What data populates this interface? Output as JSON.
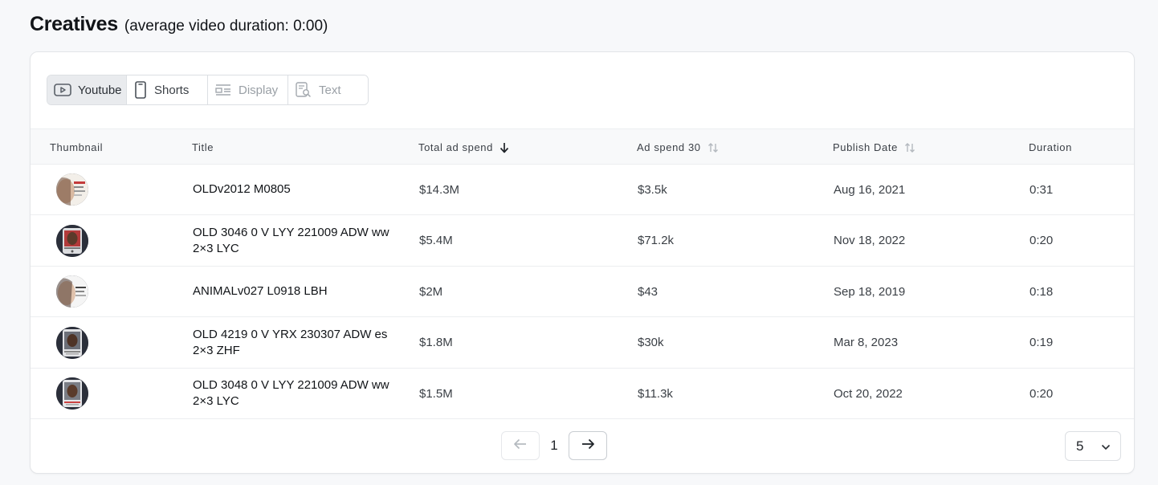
{
  "section": {
    "title": "Creatives",
    "subtitle": "(average video duration: 0:00)"
  },
  "tabs": [
    {
      "label": "Youtube",
      "icon": "youtube-icon",
      "state": "active"
    },
    {
      "label": "Shorts",
      "icon": "phone-icon",
      "state": "enabled"
    },
    {
      "label": "Display",
      "icon": "display-layout-icon",
      "state": "disabled"
    },
    {
      "label": "Text",
      "icon": "text-search-icon",
      "state": "disabled"
    }
  ],
  "table": {
    "columns": [
      {
        "label": "Thumbnail",
        "sort": "none"
      },
      {
        "label": "Title",
        "sort": "none"
      },
      {
        "label": "Total ad spend",
        "sort": "descending"
      },
      {
        "label": "Ad spend 30",
        "sort": "sortable"
      },
      {
        "label": "Publish Date",
        "sort": "sortable"
      },
      {
        "label": "Duration",
        "sort": "none"
      }
    ],
    "rows": [
      {
        "title": "OLDv2012 M0805",
        "total_ad_spend": "$14.3M",
        "ad_spend_30": "$3.5k",
        "publish_date": "Aug 16, 2021",
        "duration": "0:31"
      },
      {
        "title": "OLD 3046 0 V LYY 221009 ADW ww 2×3 LYC",
        "total_ad_spend": "$5.4M",
        "ad_spend_30": "$71.2k",
        "publish_date": "Nov 18, 2022",
        "duration": "0:20"
      },
      {
        "title": "ANIMALv027 L0918 LBH",
        "total_ad_spend": "$2M",
        "ad_spend_30": "$43",
        "publish_date": "Sep 18, 2019",
        "duration": "0:18"
      },
      {
        "title": "OLD 4219 0 V YRX 230307 ADW es 2×3 ZHF",
        "total_ad_spend": "$1.8M",
        "ad_spend_30": "$30k",
        "publish_date": "Mar 8, 2023",
        "duration": "0:19"
      },
      {
        "title": "OLD 3048 0 V LYY 221009 ADW ww 2×3 LYC",
        "total_ad_spend": "$1.5M",
        "ad_spend_30": "$11.3k",
        "publish_date": "Oct 20, 2022",
        "duration": "0:20"
      }
    ]
  },
  "pagination": {
    "current_page": "1",
    "page_size": "5"
  },
  "colors": {
    "background": "#f7f8fa",
    "card": "#ffffff",
    "active_tab": "#e9ebee",
    "disabled_text": "#9aa0a6"
  }
}
